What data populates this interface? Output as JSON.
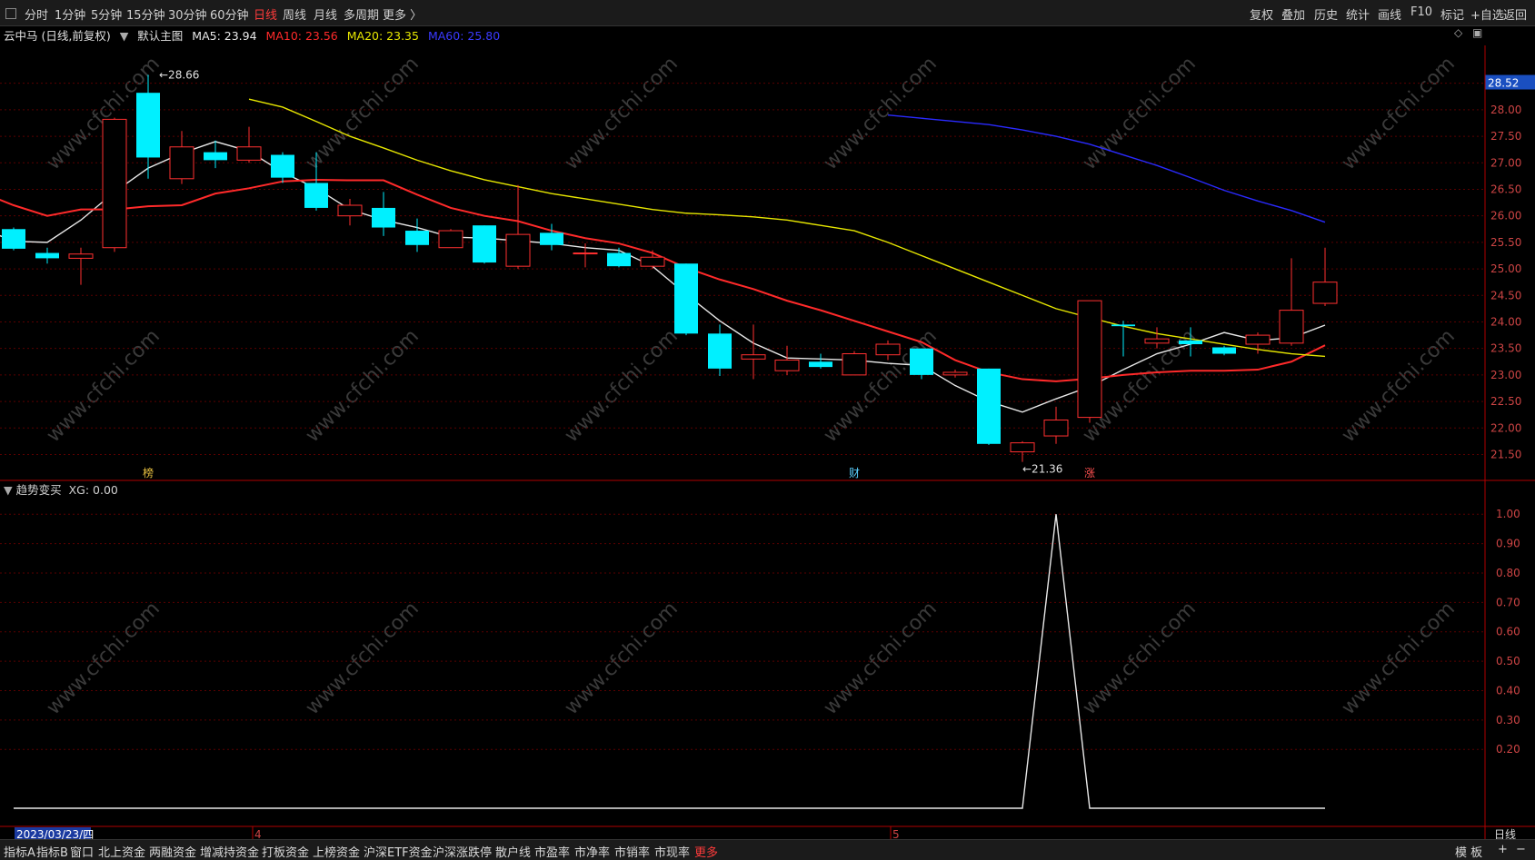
{
  "top_tabs": [
    "分时",
    "1分钟",
    "5分钟",
    "15分钟",
    "30分钟",
    "60分钟",
    "日线",
    "周线",
    "月线",
    "多周期",
    "更多 〉"
  ],
  "active_tab": "日线",
  "right_tools": [
    "复权",
    "叠加",
    "历史",
    "统计",
    "画线",
    "F10",
    "标记",
    "+自选",
    "返回"
  ],
  "stock_title": "云中马 (日线,前复权)",
  "main_title": "默认主图",
  "ma": [
    {
      "label": "MA5: 23.94",
      "color": "#e8e8e8"
    },
    {
      "label": "MA10: 23.56",
      "color": "#ff2a2a"
    },
    {
      "label": "MA20: 23.35",
      "color": "#e6e600"
    },
    {
      "label": "MA60: 25.80",
      "color": "#2a2aff"
    }
  ],
  "price_badge": "28.52",
  "high_label": "28.66",
  "low_label": "21.36",
  "event_marks": [
    {
      "text": "榜",
      "color": "#e8c040"
    },
    {
      "text": "财",
      "color": "#5bd0ff"
    },
    {
      "text": "涨",
      "color": "#ff5050"
    }
  ],
  "indicator_title": "趋势变买",
  "indicator_value": "XG: 0.00",
  "date_label": "2023/03/23/四",
  "month_labels": [
    "4",
    "5"
  ],
  "period_label": "日线",
  "bottom_tabs": [
    "指标A",
    "指标B",
    "窗口",
    "北上资金",
    "两融资金",
    "增减持资金",
    "打板资金",
    "上榜资金",
    "沪深ETF资金",
    "沪深涨跌停",
    "散户线",
    "市盈率",
    "市净率",
    "市销率",
    "市现率",
    "更多"
  ],
  "bottom_right": [
    "模 板",
    "+",
    "−"
  ],
  "watermark": "www.cfchi.com",
  "colors": {
    "up": "#ff3030",
    "down": "#00f0ff",
    "grid": "#5a0000"
  },
  "chart_data": [
    {
      "type": "candlestick",
      "title": "云中马 (日线,前复权)",
      "ylim": [
        21.2,
        28.7
      ],
      "y_ticks": [
        28.5,
        28.0,
        27.5,
        27.0,
        26.5,
        26.0,
        25.5,
        25.0,
        24.5,
        24.0,
        23.5,
        23.0,
        22.5,
        22.0,
        21.5
      ],
      "candles": [
        {
          "o": 25.75,
          "h": 25.78,
          "l": 25.35,
          "c": 25.38
        },
        {
          "o": 25.3,
          "h": 25.4,
          "l": 25.1,
          "c": 25.2
        },
        {
          "o": 25.2,
          "h": 25.4,
          "l": 24.7,
          "c": 25.28
        },
        {
          "o": 25.4,
          "h": 27.85,
          "l": 25.32,
          "c": 27.82
        },
        {
          "o": 28.32,
          "h": 28.66,
          "l": 26.7,
          "c": 27.1
        },
        {
          "o": 26.7,
          "h": 27.6,
          "l": 26.6,
          "c": 27.3
        },
        {
          "o": 27.2,
          "h": 27.42,
          "l": 26.9,
          "c": 27.05
        },
        {
          "o": 27.05,
          "h": 27.68,
          "l": 27.0,
          "c": 27.3
        },
        {
          "o": 27.15,
          "h": 27.2,
          "l": 26.62,
          "c": 26.72
        },
        {
          "o": 26.62,
          "h": 27.2,
          "l": 26.1,
          "c": 26.15
        },
        {
          "o": 26.0,
          "h": 26.32,
          "l": 25.82,
          "c": 26.2
        },
        {
          "o": 26.15,
          "h": 26.45,
          "l": 25.62,
          "c": 25.78
        },
        {
          "o": 25.72,
          "h": 25.95,
          "l": 25.32,
          "c": 25.45
        },
        {
          "o": 25.4,
          "h": 25.75,
          "l": 25.4,
          "c": 25.72
        },
        {
          "o": 25.82,
          "h": 25.82,
          "l": 25.1,
          "c": 25.12
        },
        {
          "o": 25.05,
          "h": 26.58,
          "l": 25.0,
          "c": 25.65
        },
        {
          "o": 25.68,
          "h": 25.85,
          "l": 25.35,
          "c": 25.45
        },
        {
          "o": 25.3,
          "h": 25.48,
          "l": 25.03,
          "c": 25.3
        },
        {
          "o": 25.3,
          "h": 25.4,
          "l": 25.03,
          "c": 25.05
        },
        {
          "o": 25.05,
          "h": 25.35,
          "l": 25.0,
          "c": 25.22
        },
        {
          "o": 25.1,
          "h": 25.1,
          "l": 23.75,
          "c": 23.78
        },
        {
          "o": 23.78,
          "h": 23.95,
          "l": 22.98,
          "c": 23.12
        },
        {
          "o": 23.3,
          "h": 23.95,
          "l": 22.92,
          "c": 23.38
        },
        {
          "o": 23.08,
          "h": 23.55,
          "l": 23.0,
          "c": 23.28
        },
        {
          "o": 23.25,
          "h": 23.4,
          "l": 23.12,
          "c": 23.15
        },
        {
          "o": 23.0,
          "h": 23.45,
          "l": 23.0,
          "c": 23.4
        },
        {
          "o": 23.38,
          "h": 23.65,
          "l": 23.28,
          "c": 23.58
        },
        {
          "o": 23.5,
          "h": 23.5,
          "l": 22.92,
          "c": 23.0
        },
        {
          "o": 23.0,
          "h": 23.1,
          "l": 22.95,
          "c": 23.05
        },
        {
          "o": 23.12,
          "h": 23.12,
          "l": 21.68,
          "c": 21.7
        },
        {
          "o": 21.55,
          "h": 21.75,
          "l": 21.36,
          "c": 21.72
        },
        {
          "o": 21.85,
          "h": 22.4,
          "l": 21.7,
          "c": 22.15
        },
        {
          "o": 22.2,
          "h": 24.4,
          "l": 22.1,
          "c": 24.4
        },
        {
          "o": 23.95,
          "h": 24.02,
          "l": 23.35,
          "c": 23.92
        },
        {
          "o": 23.6,
          "h": 23.9,
          "l": 23.5,
          "c": 23.68
        },
        {
          "o": 23.65,
          "h": 23.9,
          "l": 23.35,
          "c": 23.58
        },
        {
          "o": 23.52,
          "h": 23.55,
          "l": 23.37,
          "c": 23.4
        },
        {
          "o": 23.58,
          "h": 23.8,
          "l": 23.4,
          "c": 23.75
        },
        {
          "o": 23.6,
          "h": 25.2,
          "l": 23.55,
          "c": 24.22
        },
        {
          "o": 24.35,
          "h": 25.4,
          "l": 24.3,
          "c": 24.75
        }
      ],
      "series": [
        {
          "name": "MA5",
          "color": "#e8e8e8",
          "values": [
            25.78,
            25.52,
            25.5,
            25.92,
            26.45,
            26.9,
            27.18,
            27.4,
            27.22,
            26.82,
            26.52,
            26.12,
            25.92,
            25.78,
            25.6,
            25.58,
            25.53,
            25.48,
            25.4,
            25.35,
            25.05,
            24.52,
            24.02,
            23.6,
            23.32,
            23.3,
            23.28,
            23.22,
            23.18,
            22.8,
            22.5,
            22.3,
            22.55,
            22.78,
            23.1,
            23.4,
            23.58,
            23.8,
            23.65,
            23.7,
            23.94
          ]
        },
        {
          "name": "MA10",
          "color": "#ff2a2a",
          "values": [
            26.45,
            26.2,
            26.0,
            26.12,
            26.12,
            26.18,
            26.2,
            26.42,
            26.52,
            26.65,
            26.68,
            26.67,
            26.67,
            26.4,
            26.15,
            26.0,
            25.9,
            25.72,
            25.58,
            25.48,
            25.3,
            25.02,
            24.8,
            24.62,
            24.4,
            24.22,
            24.02,
            23.82,
            23.62,
            23.28,
            23.05,
            22.92,
            22.88,
            22.93,
            23.0,
            23.05,
            23.08,
            23.08,
            23.1,
            23.25,
            23.56
          ]
        },
        {
          "name": "MA20",
          "color": "#e6e600",
          "values": [
            28.2,
            28.05,
            27.78,
            27.5,
            27.28,
            27.05,
            26.85,
            26.68,
            26.55,
            26.42,
            26.32,
            26.22,
            26.12,
            26.05,
            26.02,
            25.98,
            25.92,
            25.82,
            25.72,
            25.5,
            25.25,
            25.0,
            24.75,
            24.5,
            24.25,
            24.08,
            23.92,
            23.78,
            23.68,
            23.58,
            23.48,
            23.4,
            23.35
          ]
        },
        {
          "name": "MA60",
          "color": "#2a2aff",
          "values": [
            27.9,
            27.84,
            27.78,
            27.72,
            27.62,
            27.5,
            27.35,
            27.15,
            26.95,
            26.72,
            26.48,
            26.28,
            26.1,
            25.88
          ]
        }
      ]
    },
    {
      "type": "line",
      "title": "趋势变买",
      "ylim": [
        0.0,
        1.05
      ],
      "y_ticks": [
        1.0,
        0.9,
        0.8,
        0.7,
        0.6,
        0.5,
        0.4,
        0.3,
        0.2
      ],
      "series": [
        {
          "name": "XG",
          "color": "#e8e8e8",
          "values": [
            0,
            0,
            0,
            0,
            0,
            0,
            0,
            0,
            0,
            0,
            0,
            0,
            0,
            0,
            0,
            0,
            0,
            0,
            0,
            0,
            0,
            0,
            0,
            0,
            0,
            0,
            0,
            0,
            0,
            0,
            0,
            1,
            0,
            0,
            0,
            0,
            0,
            0,
            0,
            0
          ]
        }
      ]
    }
  ]
}
